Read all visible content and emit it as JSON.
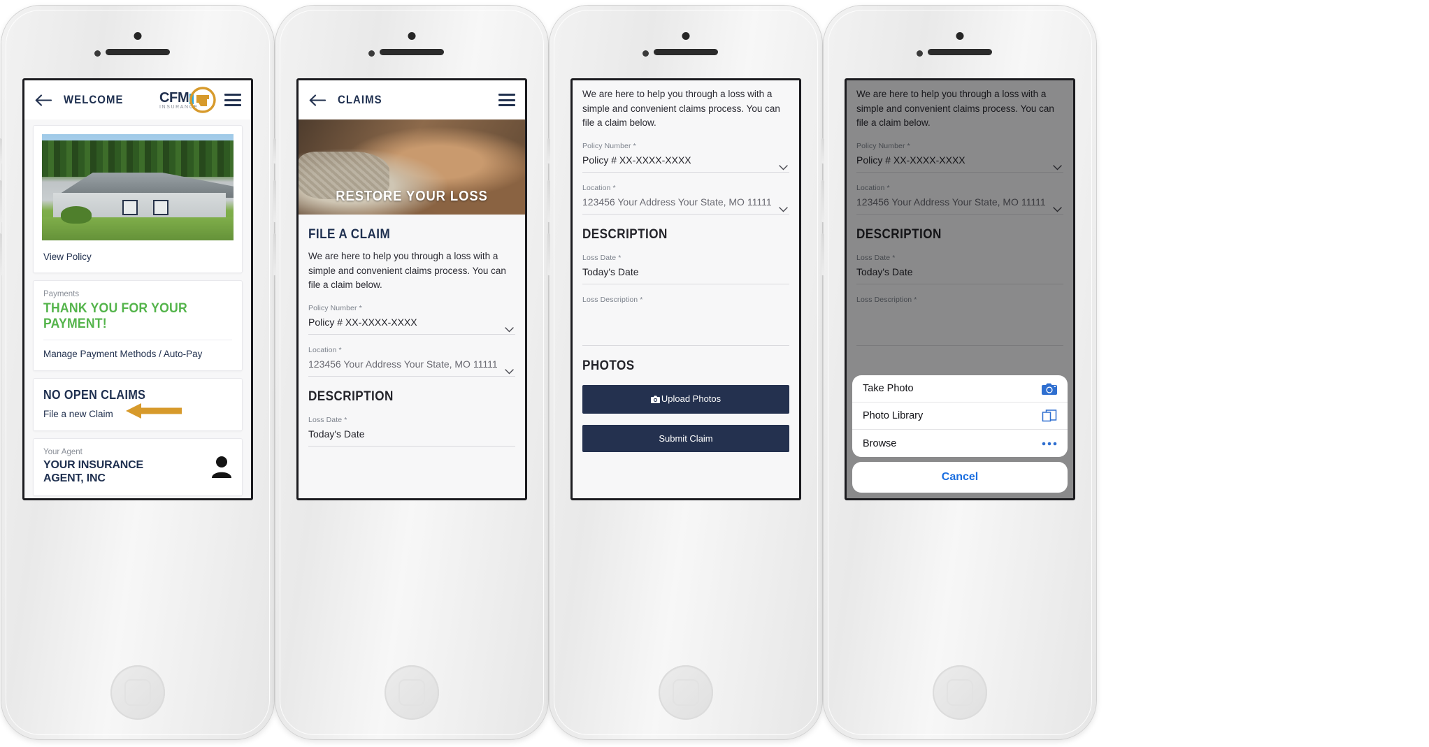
{
  "colors": {
    "navy": "#22314f",
    "navy_button": "#24314f",
    "green": "#54b44b",
    "gold": "#d79a2b",
    "ios_blue": "#1a6ee0",
    "logo_blue": "#29a8e0",
    "muted_gray": "#7c828c"
  },
  "phone1": {
    "appbar": {
      "title": "WELCOME",
      "back_icon": "arrow-left-icon",
      "menu_icon": "hamburger-icon"
    },
    "logo": {
      "text": "CFM",
      "subtext": "INSURANCE"
    },
    "policy_card": {
      "image_alt": "house-photo",
      "link": "View Policy"
    },
    "payments_card": {
      "label": "Payments",
      "headline": "THANK YOU FOR YOUR PAYMENT!",
      "link": "Manage Payment Methods / Auto-Pay"
    },
    "claims_card": {
      "headline": "NO OPEN CLAIMS",
      "link": "File a new Claim",
      "annotation_icon": "left-arrow-annotation"
    },
    "agent_card": {
      "label": "Your Agent",
      "name_line1": "YOUR INSURANCE",
      "name_line2": "AGENT, INC",
      "icon": "person-icon"
    }
  },
  "phone2": {
    "appbar": {
      "title": "CLAIMS",
      "back_icon": "arrow-left-icon",
      "menu_icon": "hamburger-icon"
    },
    "hero": {
      "text": "RESTORE YOUR LOSS",
      "image_alt": "holding-hands-photo"
    },
    "section_title": "FILE A CLAIM",
    "paragraph": "We are here to help you through a loss with a simple and convenient claims process. You can file a claim below.",
    "fields": [
      {
        "label": "Policy Number *",
        "value": "Policy # XX-XXXX-XXXX",
        "muted": false,
        "chevron": true
      },
      {
        "label": "Location *",
        "value": "123456 Your Address Your State, MO 11111",
        "muted": true,
        "chevron": true
      }
    ],
    "description_title": "DESCRIPTION",
    "loss_date": {
      "label": "Loss Date *",
      "value": "Today's Date"
    }
  },
  "phone3": {
    "paragraph_visible": "We are here to help you through a loss with a simple and convenient claims process. You can file a claim below.",
    "fields": [
      {
        "label": "Policy Number *",
        "value": "Policy # XX-XXXX-XXXX",
        "muted": false,
        "chevron": true
      },
      {
        "label": "Location *",
        "value": "123456 Your Address Your State, MO 11111",
        "muted": true,
        "chevron": true
      }
    ],
    "description_title": "DESCRIPTION",
    "loss_date": {
      "label": "Loss Date *",
      "value": "Today's Date"
    },
    "loss_description": {
      "label": "Loss Description *",
      "value": ""
    },
    "photos_title": "PHOTOS",
    "upload_button": {
      "label": "Upload Photos",
      "icon": "camera-icon"
    },
    "submit_button": {
      "label": "Submit Claim"
    }
  },
  "phone4": {
    "paragraph_visible": "We are here to help you through a loss with a simple and convenient claims process. You can file a claim below.",
    "fields": [
      {
        "label": "Policy Number *",
        "value": "Policy # XX-XXXX-XXXX",
        "muted": false,
        "chevron": true
      },
      {
        "label": "Location *",
        "value": "123456 Your Address Your State, MO 11111",
        "muted": true,
        "chevron": true
      }
    ],
    "description_title": "DESCRIPTION",
    "loss_date": {
      "label": "Loss Date *",
      "value": "Today's Date"
    },
    "loss_description": {
      "label": "Loss Description *",
      "value": ""
    },
    "action_sheet": {
      "items": [
        {
          "label": "Take Photo",
          "icon": "camera-icon"
        },
        {
          "label": "Photo Library",
          "icon": "photo-stack-icon"
        },
        {
          "label": "Browse",
          "icon": "ellipsis-icon"
        }
      ],
      "cancel": "Cancel"
    }
  }
}
